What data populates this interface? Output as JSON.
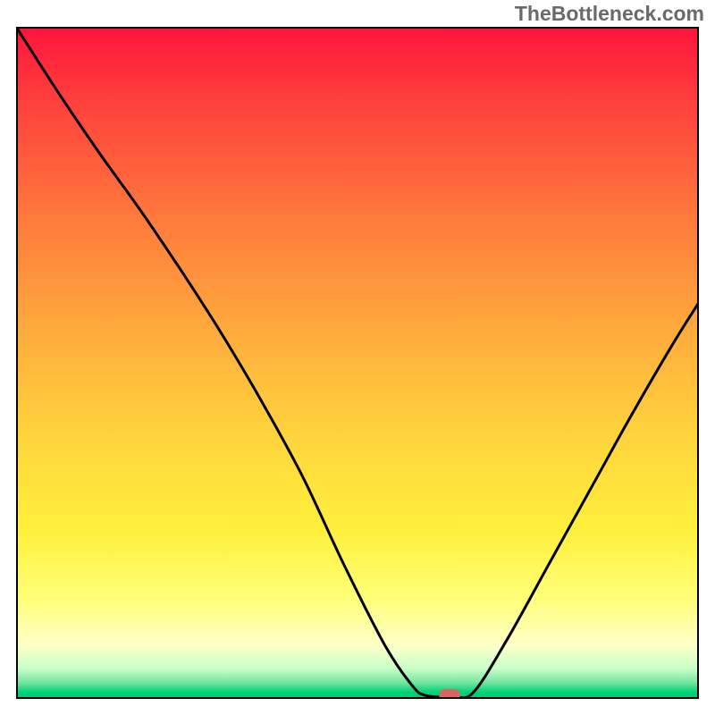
{
  "watermark": "TheBottleneck.com",
  "chart_data": {
    "type": "line",
    "title": "",
    "xlabel": "",
    "ylabel": "",
    "xlim": [
      0,
      100
    ],
    "ylim": [
      0,
      100
    ],
    "curve_norm": [
      {
        "x": 0.0,
        "y": 1.0
      },
      {
        "x": 0.06,
        "y": 0.905
      },
      {
        "x": 0.12,
        "y": 0.815
      },
      {
        "x": 0.18,
        "y": 0.73
      },
      {
        "x": 0.24,
        "y": 0.64
      },
      {
        "x": 0.3,
        "y": 0.545
      },
      {
        "x": 0.36,
        "y": 0.442
      },
      {
        "x": 0.42,
        "y": 0.33
      },
      {
        "x": 0.48,
        "y": 0.2
      },
      {
        "x": 0.54,
        "y": 0.08
      },
      {
        "x": 0.58,
        "y": 0.02
      },
      {
        "x": 0.6,
        "y": 0.005
      },
      {
        "x": 0.64,
        "y": 0.003
      },
      {
        "x": 0.67,
        "y": 0.01
      },
      {
        "x": 0.72,
        "y": 0.09
      },
      {
        "x": 0.78,
        "y": 0.2
      },
      {
        "x": 0.84,
        "y": 0.31
      },
      {
        "x": 0.9,
        "y": 0.42
      },
      {
        "x": 0.96,
        "y": 0.525
      },
      {
        "x": 1.0,
        "y": 0.59
      }
    ],
    "marker_norm": {
      "x": 0.635,
      "y": 0.0
    },
    "gradient_stops": [
      {
        "offset": 0.0,
        "color": "#ff143c"
      },
      {
        "offset": 0.1,
        "color": "#ff3c3c"
      },
      {
        "offset": 0.28,
        "color": "#ff783c"
      },
      {
        "offset": 0.45,
        "color": "#ffaa3c"
      },
      {
        "offset": 0.6,
        "color": "#ffd23c"
      },
      {
        "offset": 0.75,
        "color": "#fff03c"
      },
      {
        "offset": 0.85,
        "color": "#ffff78"
      },
      {
        "offset": 0.92,
        "color": "#ffffc8"
      },
      {
        "offset": 0.955,
        "color": "#c8ffc8"
      },
      {
        "offset": 0.975,
        "color": "#78e6a0"
      },
      {
        "offset": 0.99,
        "color": "#00d278"
      },
      {
        "offset": 1.0,
        "color": "#00c878"
      }
    ],
    "marker_color": "#d86464",
    "curve_color": "#000000",
    "frame_color": "#000000"
  }
}
